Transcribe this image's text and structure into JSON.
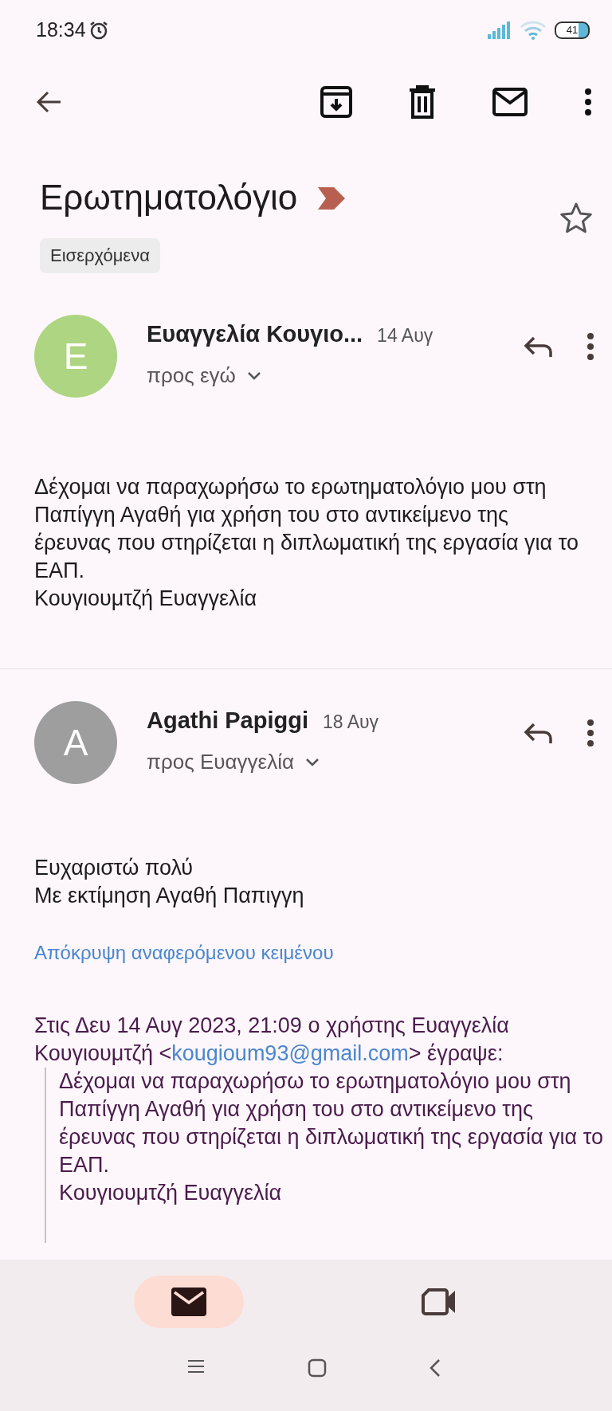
{
  "status_bar": {
    "time": "18:34",
    "battery": "41"
  },
  "subject": "Ερωτηματολόγιο",
  "important": true,
  "starred": false,
  "labels": [
    "Εισερχόμενα"
  ],
  "messages": [
    {
      "initial": "Ε",
      "color": "#aed581",
      "sender": "Ευαγγελία Κουγιο...",
      "date": "14 Αυγ",
      "recipients": "προς εγώ",
      "body": "Δέχομαι να παραχωρήσω το ερωτηματολόγιο μου στη Παπίγγη Αγαθή για χρήση του στο αντικείμενο της έρευνας που στηρίζεται η διπλωματική της εργασία για το ΕΑΠ.\nΚουγιουμτζή Ευαγγελία"
    },
    {
      "initial": "A",
      "color": "#9e9e9e",
      "sender": "Agathi Papiggi",
      "date": "18 Αυγ",
      "recipients": "προς Ευαγγελία",
      "body": " Ευχαριστώ πολύ\nΜε εκτίμηση Αγαθή Παπιγγη",
      "hide_quoted": "Απόκρυψη αναφερόμενου κειμένου",
      "quote_header_before": "Στις Δευ 14 Αυγ 2023, 21:09 ο χρήστης Ευαγγελία Κουγιουμτζή <",
      "quote_email": "kougioum93@gmail.com",
      "quote_header_after": "> έγραψε:",
      "quote_body": "Δέχομαι να παραχωρήσω το ερωτηματολόγιο μου στη Παπίγγη Αγαθή για χρήση του στο αντικείμενο της έρευνας που στηρίζεται η διπλωματική της εργασία για το ΕΑΠ.\nΚουγιουμτζή Ευαγγελία"
    }
  ],
  "bottom_nav": [
    {
      "kind": "mail",
      "selected": true
    },
    {
      "kind": "video",
      "selected": false
    }
  ]
}
